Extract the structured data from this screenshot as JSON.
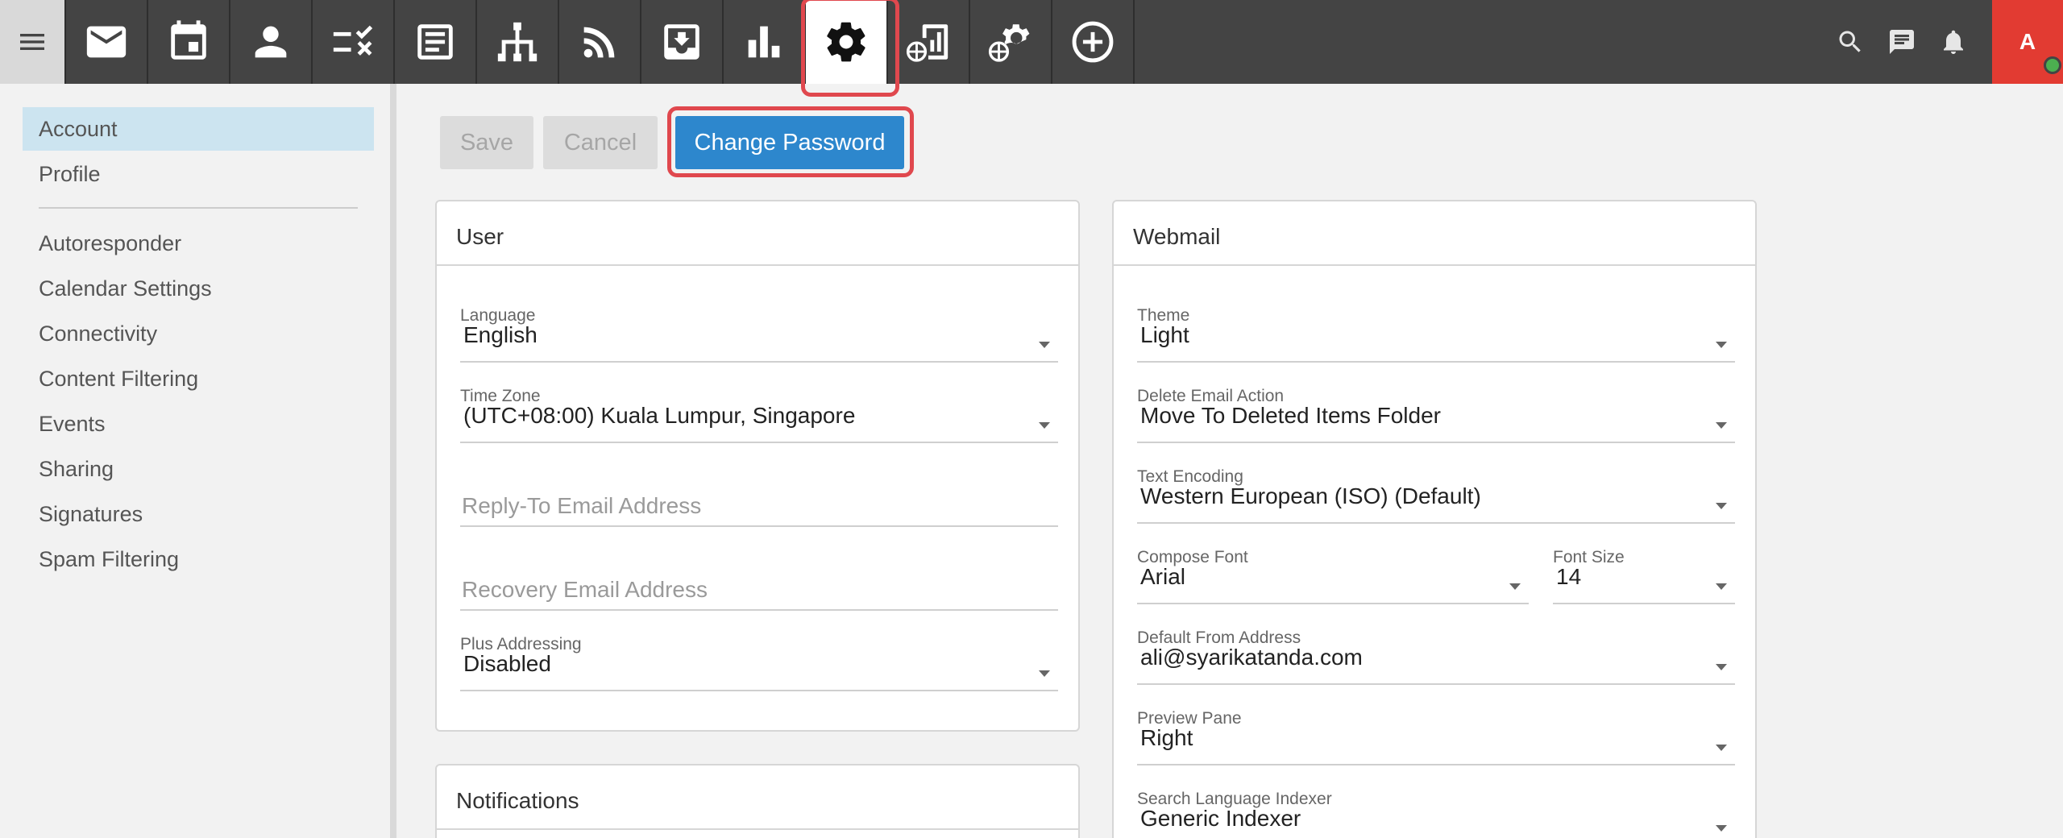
{
  "topbar": {
    "icons": [
      "menu-icon",
      "mail-icon",
      "calendar-icon",
      "contacts-icon",
      "tasks-icon",
      "notes-icon",
      "sitemap-icon",
      "rss-icon",
      "inbox-download-icon",
      "chart-icon",
      "settings-gear-icon",
      "domain-reports-icon",
      "domain-settings-icon",
      "add-circle-icon"
    ],
    "active": "settings-gear-icon",
    "right_icons": [
      "search-icon",
      "chat-icon",
      "bell-icon"
    ],
    "avatar_letter": "A",
    "avatar_color": "#e23b32",
    "status_color": "#4caf50"
  },
  "sidebar": {
    "items": [
      {
        "label": "Account",
        "active": true
      },
      {
        "label": "Profile"
      },
      {
        "label": "Autoresponder"
      },
      {
        "label": "Calendar Settings"
      },
      {
        "label": "Connectivity"
      },
      {
        "label": "Content Filtering"
      },
      {
        "label": "Events"
      },
      {
        "label": "Sharing"
      },
      {
        "label": "Signatures"
      },
      {
        "label": "Spam Filtering"
      }
    ]
  },
  "toolbar": {
    "save_label": "Save",
    "cancel_label": "Cancel",
    "change_password_label": "Change Password"
  },
  "user_panel": {
    "title": "User",
    "language": {
      "label": "Language",
      "value": "English"
    },
    "timezone": {
      "label": "Time Zone",
      "value": "(UTC+08:00) Kuala Lumpur, Singapore"
    },
    "reply_to": {
      "placeholder": "Reply-To Email Address"
    },
    "recovery": {
      "placeholder": "Recovery Email Address"
    },
    "plus_addressing": {
      "label": "Plus Addressing",
      "value": "Disabled"
    }
  },
  "notifications_panel": {
    "title": "Notifications"
  },
  "webmail_panel": {
    "title": "Webmail",
    "theme": {
      "label": "Theme",
      "value": "Light"
    },
    "delete_action": {
      "label": "Delete Email Action",
      "value": "Move To Deleted Items Folder"
    },
    "text_encoding": {
      "label": "Text Encoding",
      "value": "Western European (ISO) (Default)"
    },
    "compose_font": {
      "label": "Compose Font",
      "value": "Arial"
    },
    "font_size": {
      "label": "Font Size",
      "value": "14"
    },
    "default_from": {
      "label": "Default From Address",
      "value": "ali@syarikatanda.com"
    },
    "preview_pane": {
      "label": "Preview Pane",
      "value": "Right"
    },
    "search_indexer": {
      "label": "Search Language Indexer",
      "value": "Generic Indexer"
    }
  }
}
